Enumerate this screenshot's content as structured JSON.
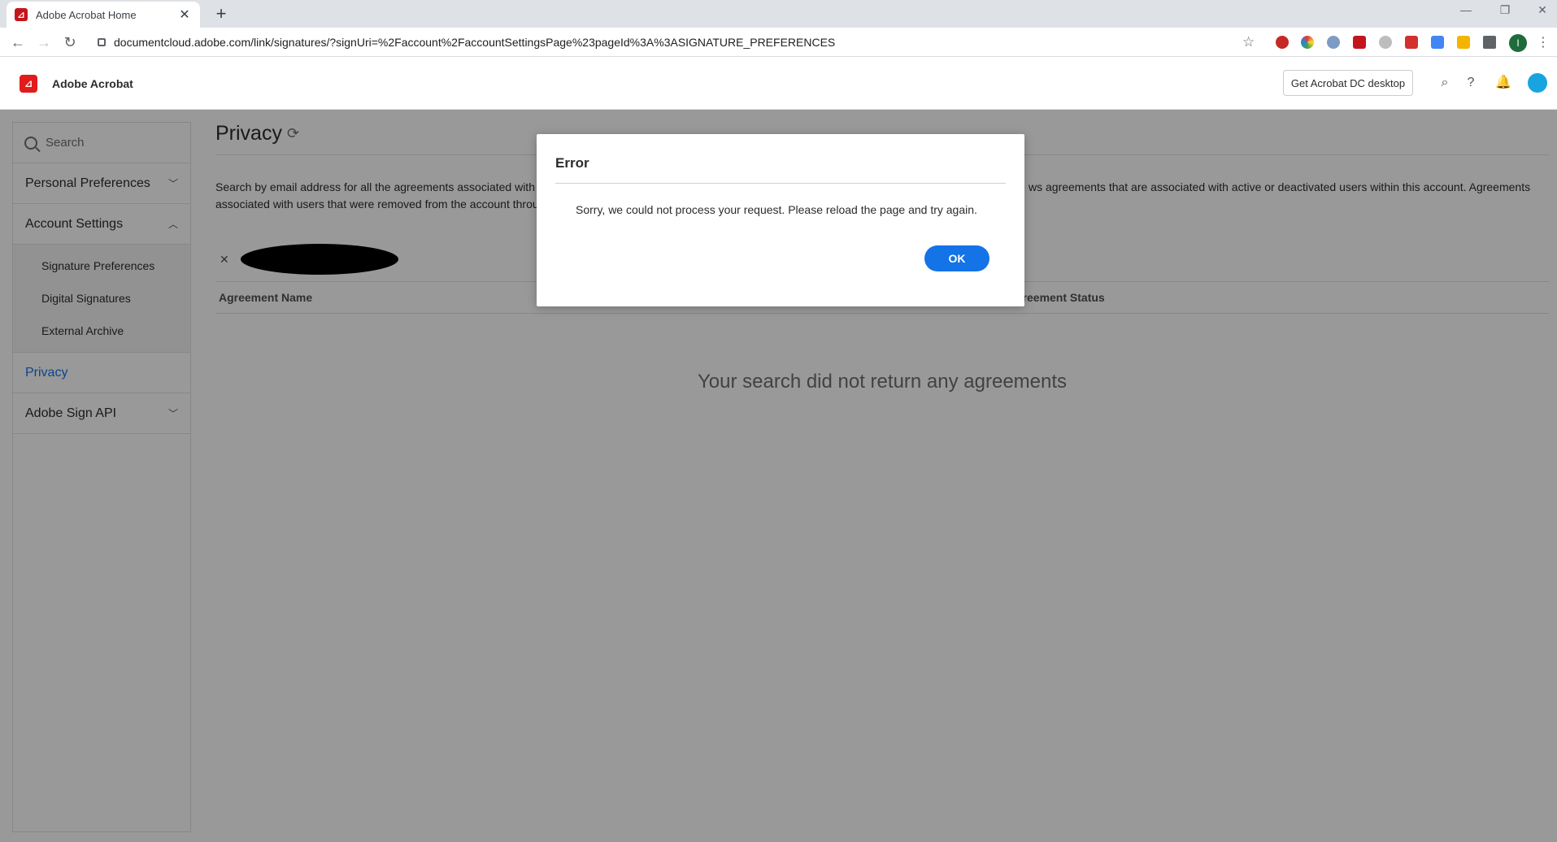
{
  "browser": {
    "tab_title": "Adobe Acrobat Home",
    "url": "documentcloud.adobe.com/link/signatures/?signUri=%2Faccount%2FaccountSettingsPage%23pageId%3A%3ASIGNATURE_PREFERENCES",
    "profile_initial": "I"
  },
  "header": {
    "app_title": "Adobe Acrobat",
    "get_desktop_label": "Get Acrobat DC desktop"
  },
  "sidebar": {
    "search_placeholder": "Search",
    "personal_preferences": "Personal Preferences",
    "account_settings": "Account Settings",
    "sub_items": [
      "Signature Preferences",
      "Digital Signatures",
      "External Archive"
    ],
    "privacy": "Privacy",
    "adobe_sign_api": "Adobe Sign API"
  },
  "main": {
    "title": "Privacy",
    "description_left": "Search by email address for all the agreements associated with a",
    "description_left_2": "associated with users that were removed from the account throu",
    "description_right": "ws agreements that are associated with active or deactivated users within this account. Agreements",
    "columns": [
      "Agreement Name",
      "greement Status"
    ],
    "empty_message": "Your search did not return any agreements"
  },
  "dialog": {
    "title": "Error",
    "message": "Sorry, we could not process your request. Please reload the page and try again.",
    "ok_label": "OK"
  },
  "colors": {
    "accent": "#1473e6",
    "acrobat_red": "#e21b1b"
  }
}
